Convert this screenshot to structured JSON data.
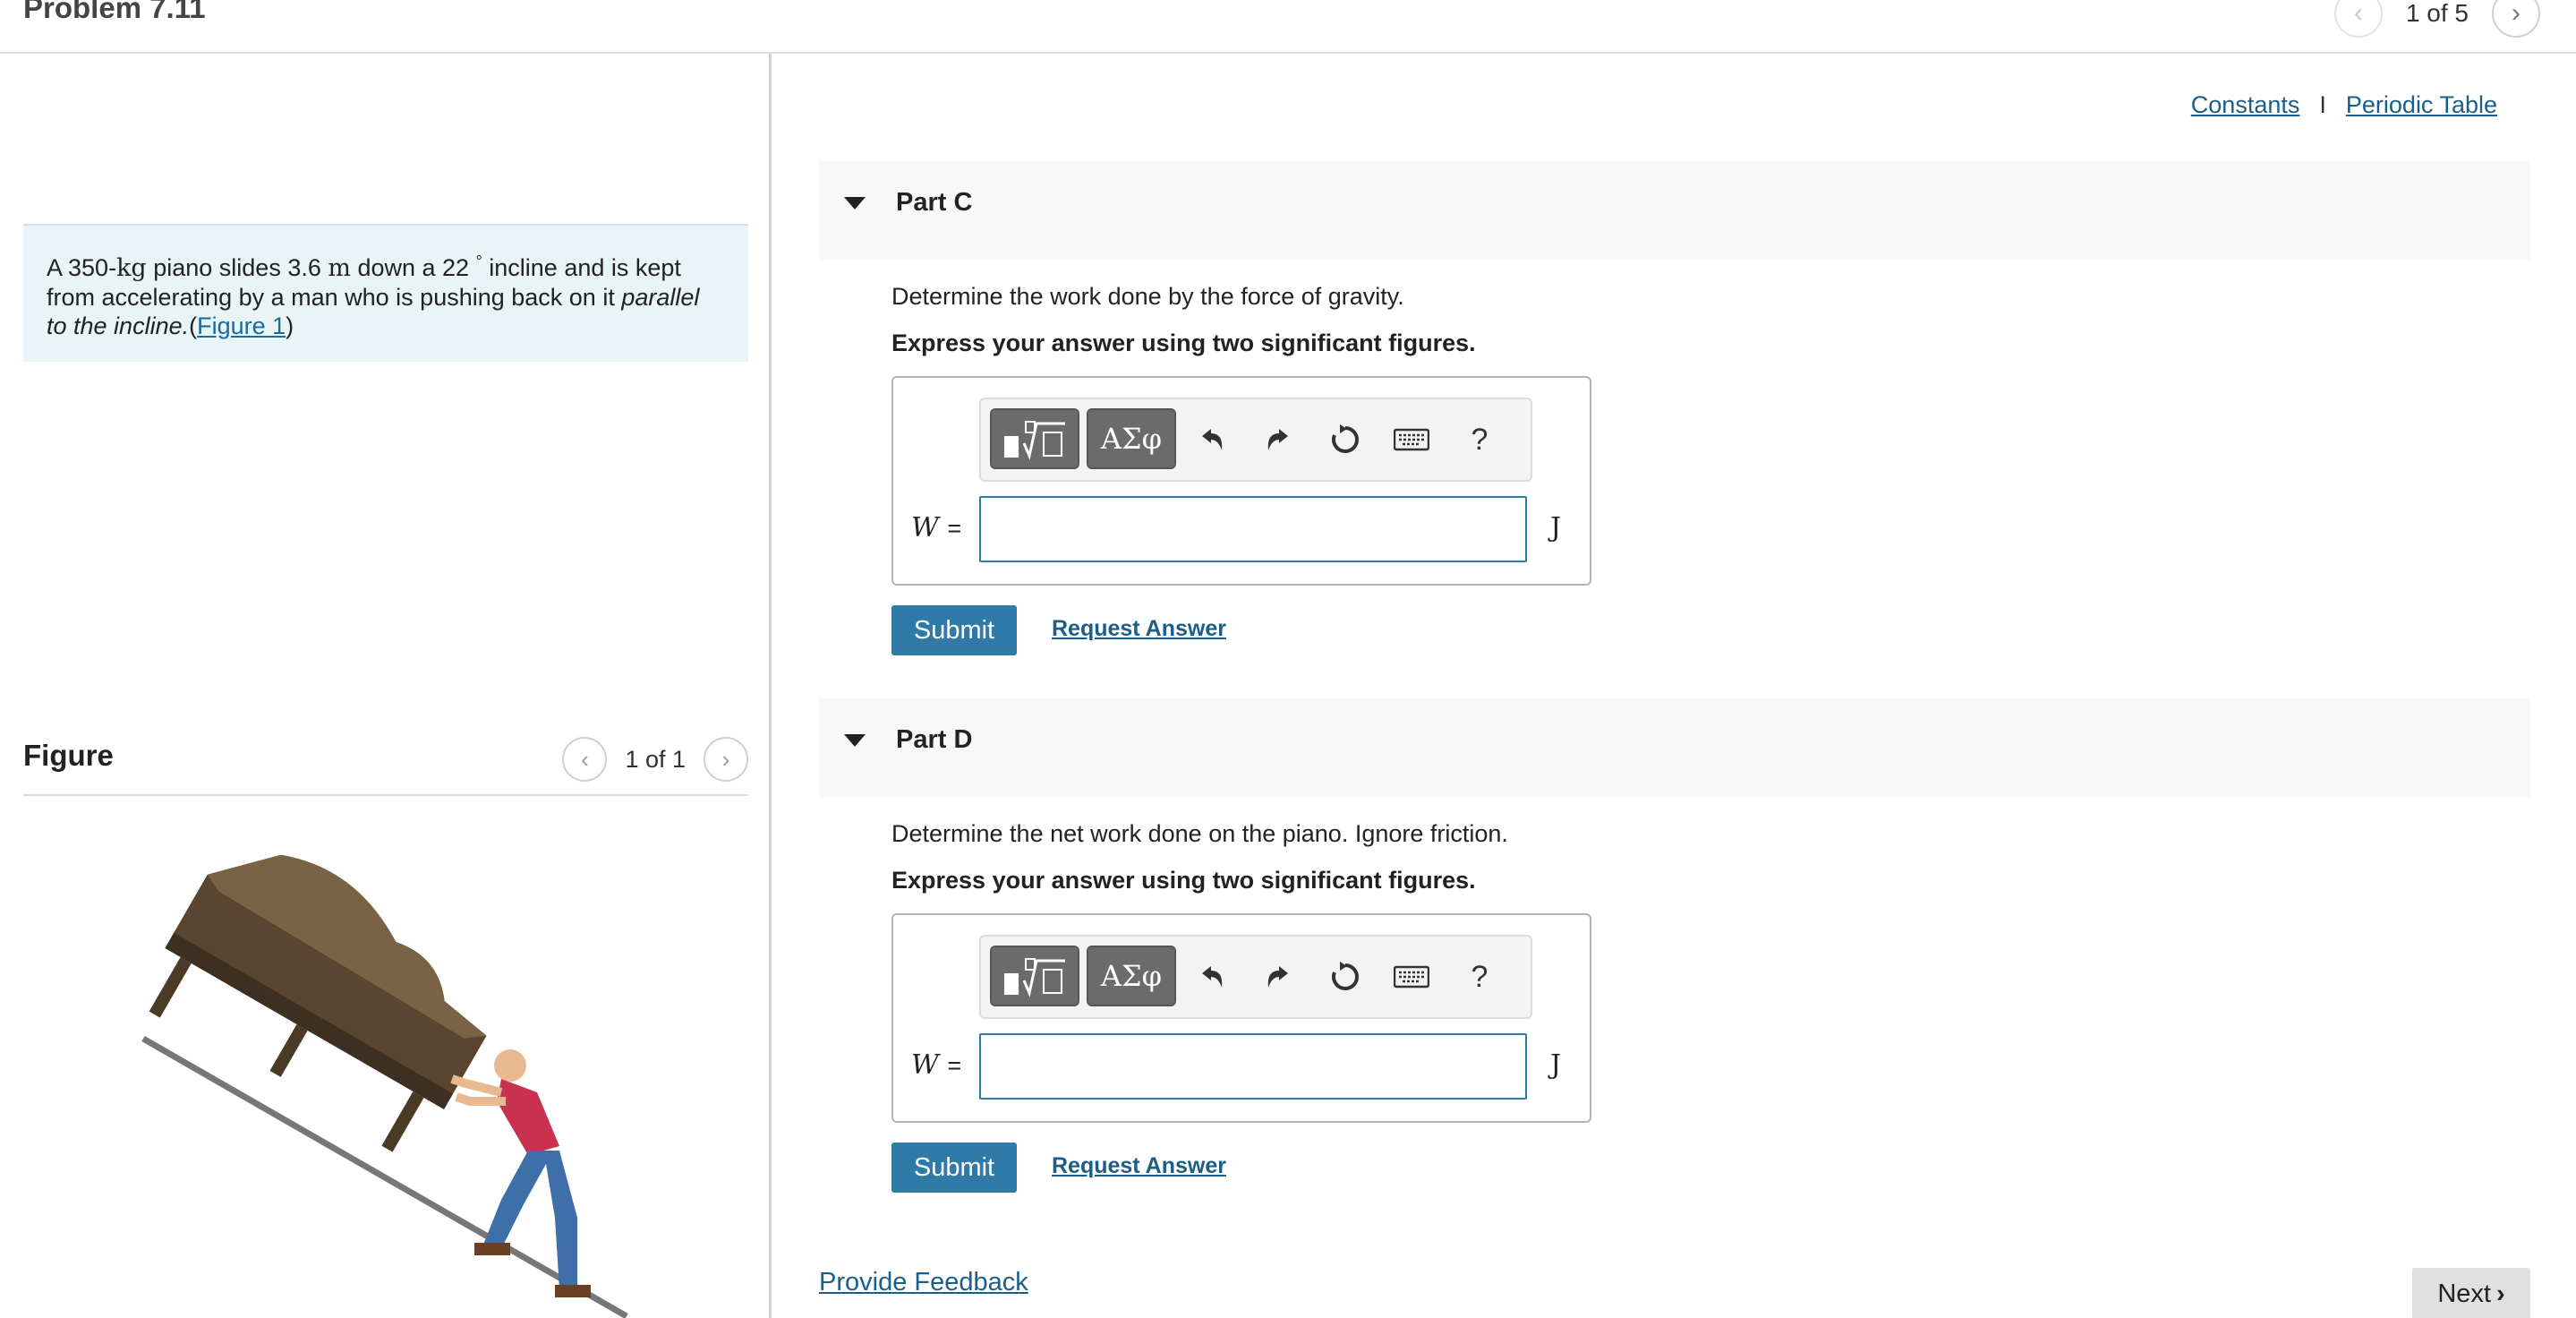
{
  "header": {
    "problem_title": "Problem 7.11",
    "count": "1 of 5"
  },
  "problem": {
    "statement": {
      "t1": "A 350-",
      "mass_unit": "kg",
      "t2": " piano slides 3.6 ",
      "dist_unit": "m",
      "t3": " down a 22 ",
      "degree": "°",
      "t4": " incline and is kept from accelerating by a man who is pushing back on it ",
      "emph": "parallel to the incline.",
      "paren_open": "(",
      "figure_link": "Figure 1",
      "paren_close": ")"
    }
  },
  "figure": {
    "title": "Figure",
    "count": "1 of 1"
  },
  "links": {
    "constants": "Constants",
    "separator": "I",
    "periodic_table": "Periodic Table"
  },
  "parts": [
    {
      "label": "Part C",
      "question": "Determine the work done by the force of gravity.",
      "hint": "Express your answer using two significant figures.",
      "variable": "W",
      "equals": "=",
      "unit": "J",
      "input_value": "",
      "submit": "Submit",
      "request": "Request Answer"
    },
    {
      "label": "Part D",
      "question": "Determine the net work done on the piano. Ignore friction.",
      "hint": "Express your answer using two significant figures.",
      "variable": "W",
      "equals": "=",
      "unit": "J",
      "input_value": "",
      "submit": "Submit",
      "request": "Request Answer"
    }
  ],
  "toolbar": {
    "greek_label": "ΑΣφ",
    "help_label": "?",
    "icons": [
      "templates-icon",
      "undo-icon",
      "redo-icon",
      "reset-icon",
      "keyboard-icon"
    ]
  },
  "footer": {
    "feedback": "Provide Feedback",
    "next": "Next"
  },
  "colors": {
    "accent": "#2f7aa7",
    "link": "#1a5f8a",
    "statement_bg": "#e8f4f6"
  }
}
